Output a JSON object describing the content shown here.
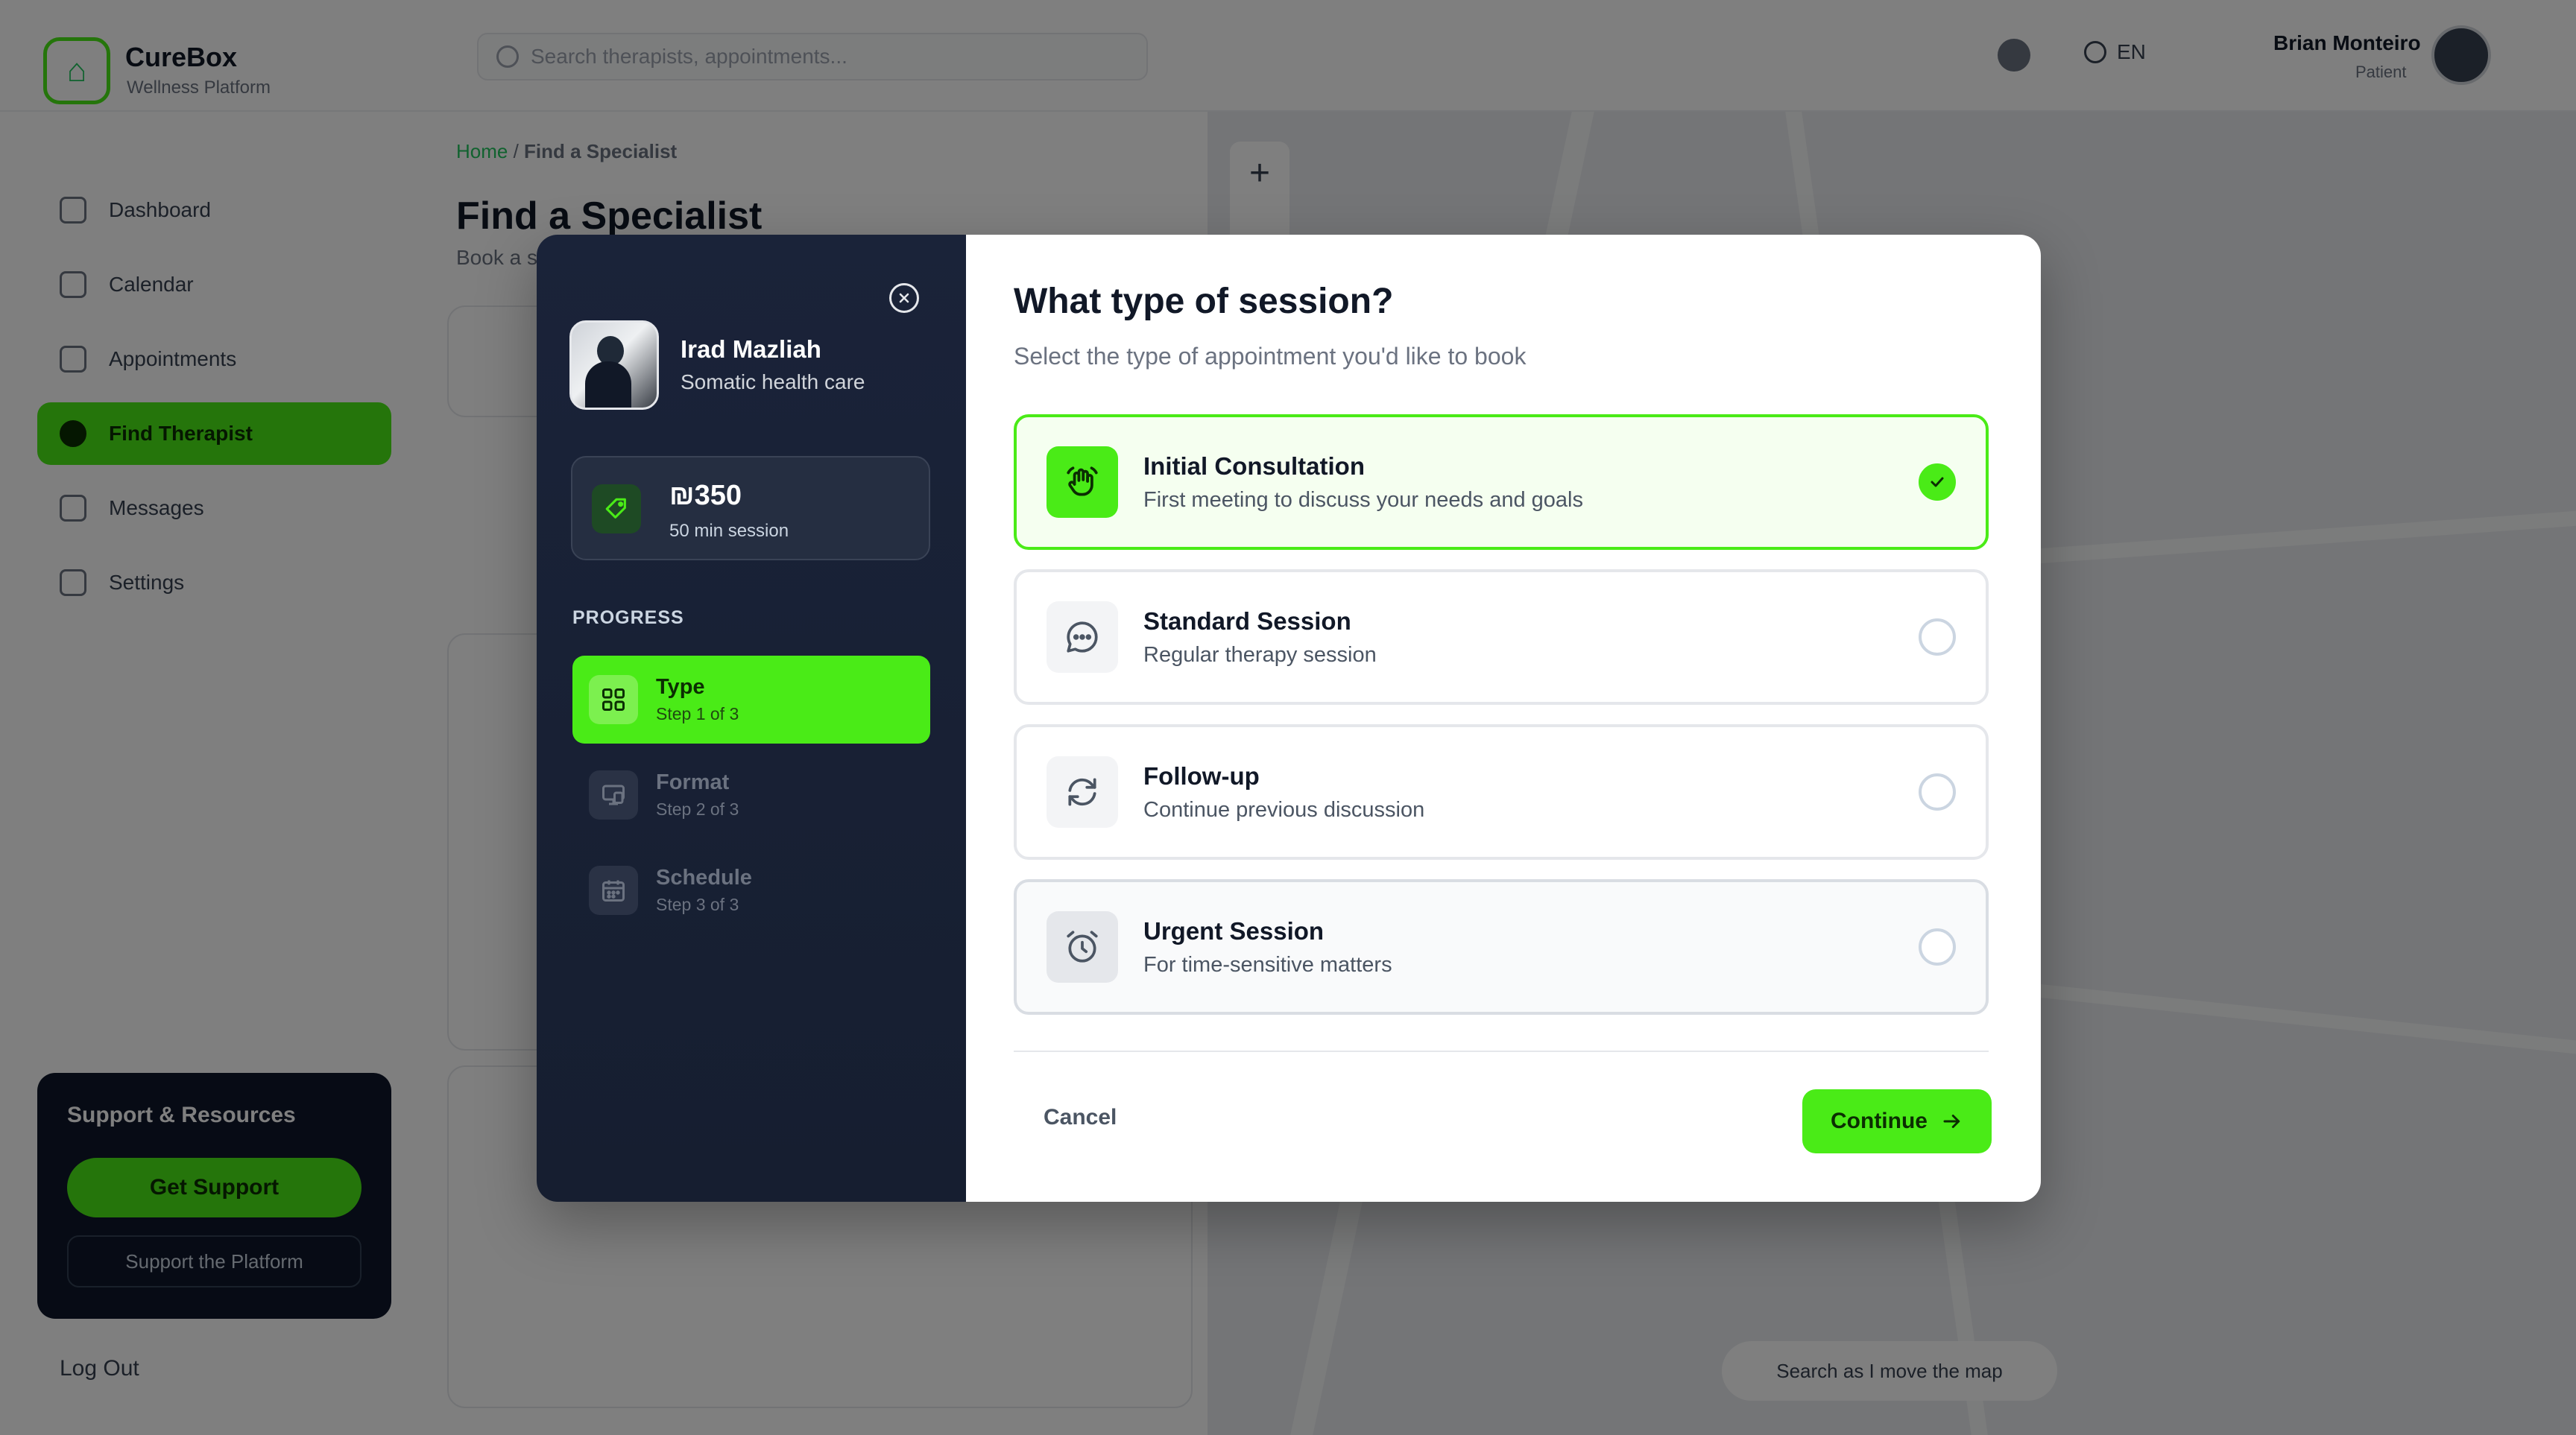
{
  "app": {
    "brand": "CureBox",
    "brand_sub": "Wellness Platform",
    "search_placeholder": "Search therapists, appointments...",
    "language": "EN",
    "user_name": "Brian Monteiro",
    "user_role": "Patient",
    "nav": [
      "Dashboard",
      "Calendar",
      "Appointments",
      "Find Therapist",
      "Messages",
      "Settings"
    ],
    "support_title": "Support & Resources",
    "support_button": "Get Support",
    "support_platform": "Support the Platform",
    "logout": "Log Out",
    "breadcrumb_home": "Home",
    "breadcrumb_current": "Find a Specialist",
    "page_title": "Find a Specialist",
    "page_subtitle": "Book a session with a specialist",
    "map_search": "Search as I move the map"
  },
  "modal": {
    "therapist": {
      "name": "Irad Mazliah",
      "specialty": "Somatic health care"
    },
    "price": {
      "amount": "₪350",
      "duration": "50 min session"
    },
    "progress_title": "PROGRESS",
    "steps": [
      {
        "name": "Type",
        "sub": "Step 1 of 3",
        "active": true
      },
      {
        "name": "Format",
        "sub": "Step 2 of 3",
        "active": false
      },
      {
        "name": "Schedule",
        "sub": "Step 3 of 3",
        "active": false
      }
    ],
    "question": "What type of session?",
    "question_sub": "Select the type of appointment you'd like to book",
    "options": [
      {
        "name": "Initial Consultation",
        "desc": "First meeting to discuss your needs and goals",
        "icon": "hand-wave-icon",
        "selected": true
      },
      {
        "name": "Standard Session",
        "desc": "Regular therapy session",
        "icon": "chat-bubble-icon",
        "selected": false
      },
      {
        "name": "Follow-up",
        "desc": "Continue previous discussion",
        "icon": "refresh-icon",
        "selected": false
      },
      {
        "name": "Urgent Session",
        "desc": "For time-sensitive matters",
        "icon": "alarm-clock-icon",
        "selected": false
      }
    ],
    "cancel_label": "Cancel",
    "continue_label": "Continue"
  },
  "colors": {
    "accent": "#4aeb17",
    "sidebar_bg": "#1a2339",
    "overlay": "rgba(0,0,0,0.5)"
  }
}
